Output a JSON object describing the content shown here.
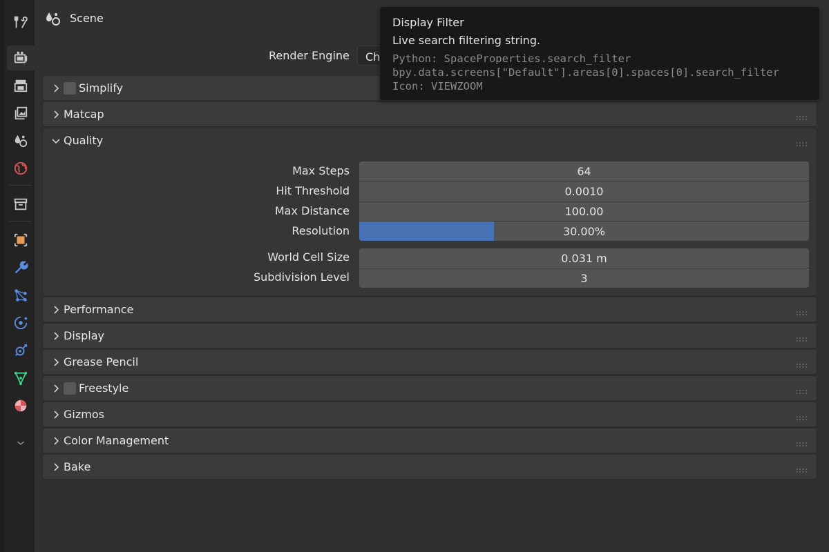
{
  "header": {
    "title": "Scene"
  },
  "render": {
    "label": "Render Engine",
    "value": "Ch"
  },
  "sidebar": {
    "tabs": [
      {
        "icon": "tool-icon",
        "color": "#c8c8c8"
      },
      {
        "icon": "render-icon",
        "color": "#c8c8c8",
        "active": true
      },
      {
        "icon": "output-icon",
        "color": "#c8c8c8"
      },
      {
        "icon": "view-layer-icon",
        "color": "#c8c8c8"
      },
      {
        "icon": "scene-icon",
        "color": "#c8c8c8"
      },
      {
        "icon": "world-icon",
        "color": "#d9575b"
      },
      {
        "icon": "collection-icon",
        "color": "#c8c8c8"
      },
      {
        "icon": "object-icon",
        "color": "#e99a57"
      },
      {
        "icon": "modifier-icon",
        "color": "#5a8ee0"
      },
      {
        "icon": "particles-icon",
        "color": "#5a8ee0"
      },
      {
        "icon": "physics-icon",
        "color": "#5a8ee0"
      },
      {
        "icon": "constraints-icon",
        "color": "#5a8ee0"
      },
      {
        "icon": "data-icon",
        "color": "#3dd68c"
      },
      {
        "icon": "material-icon",
        "color": "#d9575b"
      },
      {
        "icon": "chevron-down-icon",
        "color": "#8a8a8a"
      }
    ]
  },
  "panels": {
    "simplify": "Simplify",
    "matcap": "Matcap",
    "quality": "Quality",
    "performance": "Performance",
    "display": "Display",
    "grease_pencil": "Grease Pencil",
    "freestyle": "Freestyle",
    "gizmos": "Gizmos",
    "color_management": "Color Management",
    "bake": "Bake"
  },
  "quality": {
    "max_steps": {
      "label": "Max Steps",
      "value": "64"
    },
    "hit_threshold": {
      "label": "Hit Threshold",
      "value": "0.0010"
    },
    "max_distance": {
      "label": "Max Distance",
      "value": "100.00"
    },
    "resolution": {
      "label": "Resolution",
      "value": "30.00%",
      "fraction": 0.3
    },
    "world_cell_size": {
      "label": "World Cell Size",
      "value": "0.031 m"
    },
    "subdivision_level": {
      "label": "Subdivision Level",
      "value": "3"
    }
  },
  "tooltip": {
    "title": "Display Filter",
    "description": "Live search filtering string.",
    "python": "Python: SpaceProperties.search_filter",
    "path": "bpy.data.screens[\"Default\"].areas[0].spaces[0].search_filter",
    "icon": "Icon: VIEWZOOM"
  },
  "colors": {
    "accent": "#4772b3",
    "panel": "#3b3b3b",
    "background": "#303030"
  }
}
